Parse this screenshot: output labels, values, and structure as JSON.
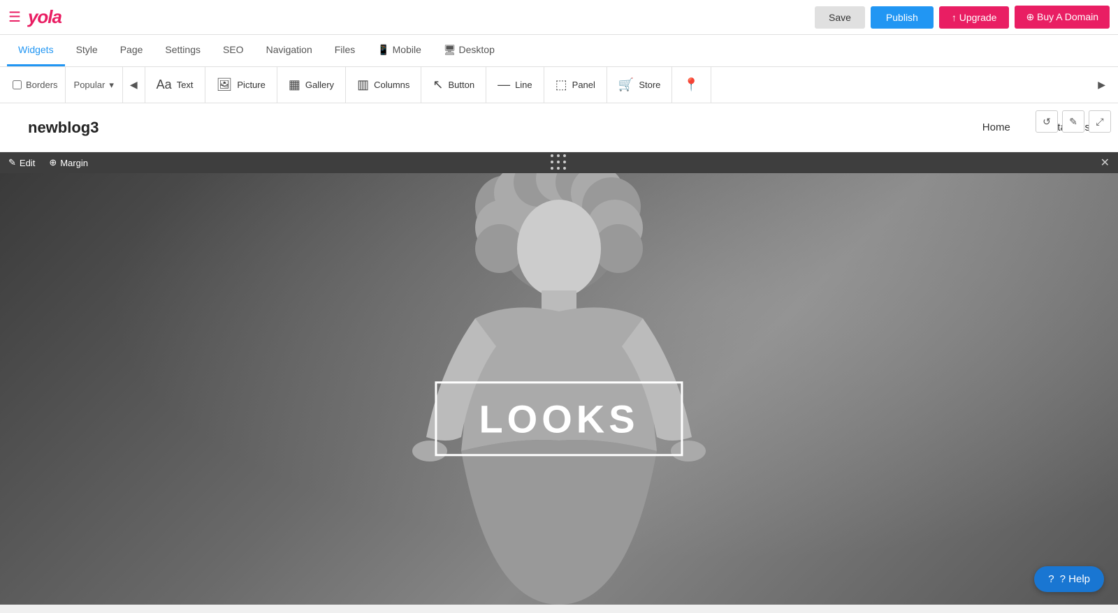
{
  "topbar": {
    "menu_icon": "☰",
    "logo": "yola",
    "save_label": "Save",
    "publish_label": "Publish",
    "upgrade_label": "↑ Upgrade",
    "domain_label": "⊕ Buy A Domain"
  },
  "nav_tabs": [
    {
      "label": "Widgets",
      "active": true
    },
    {
      "label": "Style",
      "active": false
    },
    {
      "label": "Page",
      "active": false
    },
    {
      "label": "Settings",
      "active": false
    },
    {
      "label": "SEO",
      "active": false
    },
    {
      "label": "Navigation",
      "active": false
    },
    {
      "label": "Files",
      "active": false
    },
    {
      "label": "Mobile",
      "active": false
    },
    {
      "label": "Desktop",
      "active": false
    }
  ],
  "widget_bar": {
    "borders_label": "Borders",
    "popular_label": "Popular",
    "arrow_left": "◀",
    "arrow_right": "▶",
    "widgets": [
      {
        "icon": "Aa",
        "label": "Text"
      },
      {
        "icon": "🖼",
        "label": "Picture"
      },
      {
        "icon": "⊞",
        "label": "Gallery"
      },
      {
        "icon": "▦",
        "label": "Columns"
      },
      {
        "icon": "↖",
        "label": "Button"
      },
      {
        "icon": "—",
        "label": "Line"
      },
      {
        "icon": "⬚",
        "label": "Panel"
      },
      {
        "icon": "🛒",
        "label": "Store"
      },
      {
        "icon": "📍",
        "label": ""
      }
    ]
  },
  "preview": {
    "site_name": "newblog3",
    "nav_items": [
      "Home",
      "Contact Us"
    ],
    "action_btns": [
      "↺",
      "✎",
      "⤢"
    ]
  },
  "edit_bar": {
    "edit_label": "✎ Edit",
    "margin_label": "⊕ Margin",
    "close_label": "✕"
  },
  "hero": {
    "text": "LOOKS"
  },
  "help": {
    "label": "? Help"
  }
}
